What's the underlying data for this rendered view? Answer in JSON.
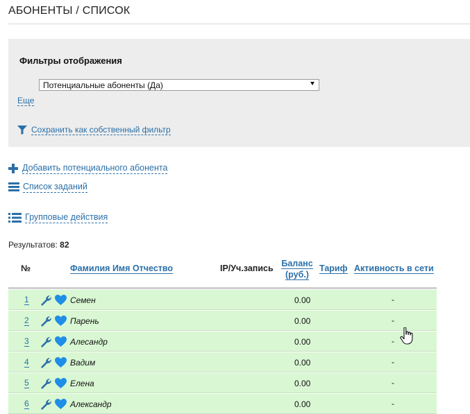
{
  "page": {
    "title": "АБОНЕНТЫ / СПИСОК"
  },
  "filters": {
    "heading": "Фильтры отображения",
    "select_value": "Потенциальные абоненты (Да)",
    "more_label": "Еще",
    "save_label": "Сохранить как собственный фильтр"
  },
  "actions": {
    "add_label": "Добавить потенциального абонента",
    "tasks_label": "Список заданий",
    "group_label": "Групповые действия"
  },
  "results": {
    "label": "Результатов:",
    "count": "82"
  },
  "table": {
    "headers": {
      "no": "№",
      "fio": "Фамилия Имя Отчество",
      "ip": "IP/Уч.запись",
      "balance_line1": "Баланс",
      "balance_line2": "(руб.)",
      "tariff": "Тариф",
      "activity": "Активность в сети"
    },
    "rows": [
      {
        "num": "1",
        "name": "Семен",
        "balance": "0.00",
        "activity": "-"
      },
      {
        "num": "2",
        "name": "Парень",
        "balance": "0.00",
        "activity": "-"
      },
      {
        "num": "3",
        "name": "Алесандр",
        "balance": "0.00",
        "activity": "-"
      },
      {
        "num": "4",
        "name": "Вадим",
        "balance": "0.00",
        "activity": "-"
      },
      {
        "num": "5",
        "name": "Елена",
        "balance": "0.00",
        "activity": "-"
      },
      {
        "num": "6",
        "name": "Александр",
        "balance": "0.00",
        "activity": "-"
      }
    ]
  },
  "colors": {
    "link": "#2a6fa8",
    "row_bg": "#d9f7d3",
    "filter_bg": "#ededed"
  },
  "icons": [
    "filter-icon",
    "plus-icon",
    "list-icon",
    "bulleted-list-icon",
    "wrench-icon",
    "heart-icon",
    "hand-cursor-icon"
  ]
}
